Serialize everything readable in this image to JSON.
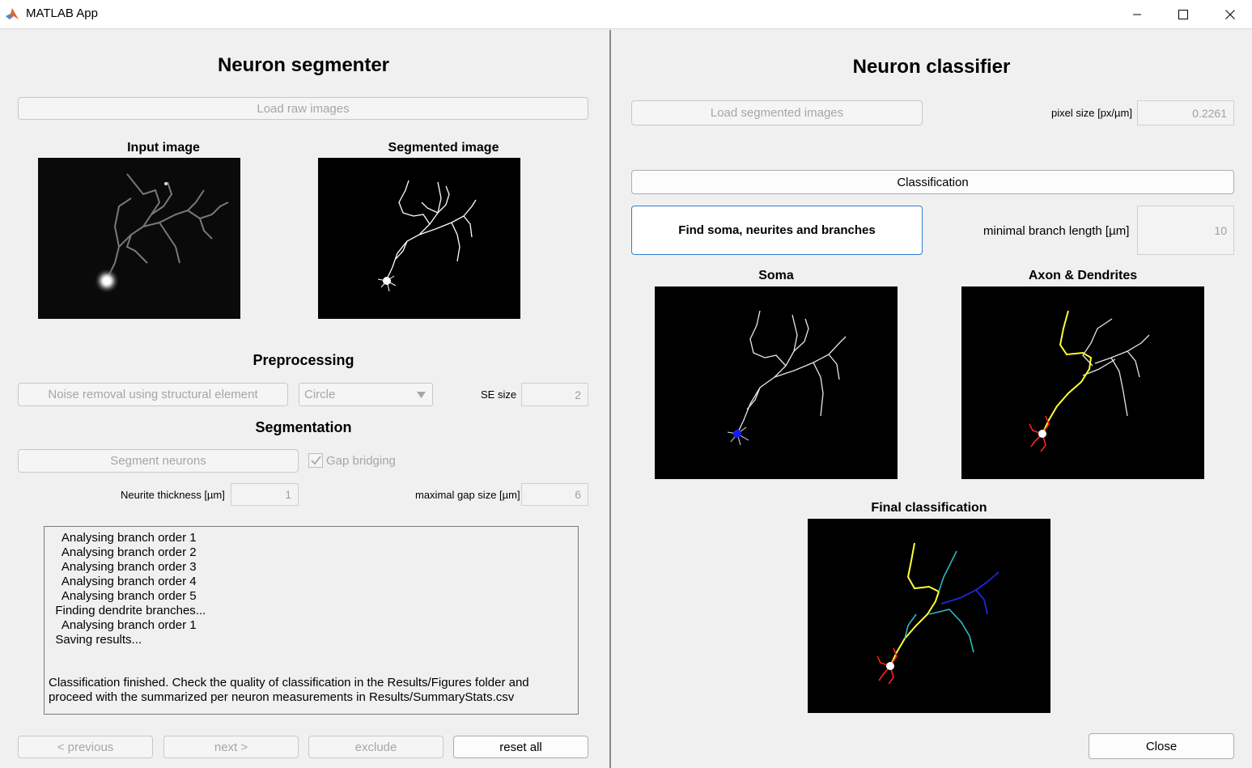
{
  "window": {
    "title": "MATLAB App",
    "minimize_icon": "minimize-icon",
    "maximize_icon": "maximize-icon",
    "close_icon": "close-icon"
  },
  "segmenter": {
    "title": "Neuron segmenter",
    "load_button": "Load raw images",
    "input_image_title": "Input image",
    "segmented_image_title": "Segmented image",
    "preprocessing_title": "Preprocessing",
    "noise_button": "Noise removal using structural element",
    "shape_select": "Circle",
    "se_size_label": "SE size",
    "se_size_value": "2",
    "segmentation_title": "Segmentation",
    "segment_button": "Segment neurons",
    "gap_bridging_label": "Gap bridging",
    "gap_bridging_checked": true,
    "neurite_thickness_label": "Neurite thickness [µm]",
    "neurite_thickness_value": "1",
    "gap_size_label": "maximal gap size [µm]",
    "gap_size_value": "6",
    "log_lines": [
      "    Analysing branch order 1",
      "    Analysing branch order 2",
      "    Analysing branch order 3",
      "    Analysing branch order 4",
      "    Analysing branch order 5",
      "  Finding dendrite branches...",
      "    Analysing branch order 1",
      "  Saving results..."
    ],
    "log_final": "Classification finished. Check the quality of classification in the Results/Figures folder and proceed with the summarized per neuron measurements in Results/SummaryStats.csv",
    "prev_button": "< previous",
    "next_button": "next >",
    "exclude_button": "exclude",
    "reset_button": "reset all"
  },
  "classifier": {
    "title": "Neuron classifier",
    "load_button": "Load segmented images",
    "pixel_size_label": "pixel size [px/µm]",
    "pixel_size_value": "0.2261",
    "classification_button": "Classification",
    "find_button": "Find soma, neurites and branches",
    "min_branch_label": "minimal branch length [µm]",
    "min_branch_value": "10",
    "soma_title": "Soma",
    "axon_title": "Axon & Dendrites",
    "final_title": "Final classification",
    "close_button": "Close"
  },
  "colors": {
    "soma": "#1a1aff",
    "axon": "#ffff33",
    "dendrite": "#ff2020",
    "branch_cyan": "#2fb7c9",
    "branch_blue": "#1a2ad9"
  }
}
